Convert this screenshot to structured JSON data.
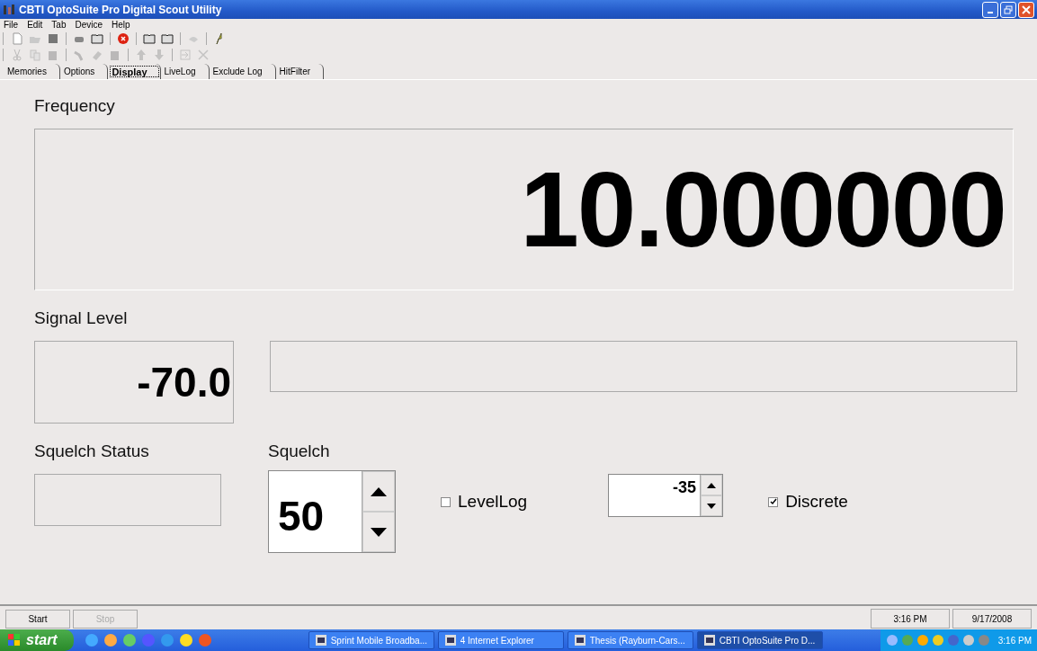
{
  "window": {
    "title": "CBTI OptoSuite Pro Digital Scout Utility"
  },
  "menu": [
    "File",
    "Edit",
    "Tab",
    "Device",
    "Help"
  ],
  "tabs": [
    {
      "label": "Memories",
      "selected": false
    },
    {
      "label": "Options",
      "selected": false
    },
    {
      "label": "Display",
      "selected": true
    },
    {
      "label": "LiveLog",
      "selected": false
    },
    {
      "label": "Exclude Log",
      "selected": false
    },
    {
      "label": "HitFilter",
      "selected": false
    }
  ],
  "frequency": {
    "label": "Frequency",
    "value": "10.000000"
  },
  "signal": {
    "label": "Signal Level",
    "reading": "-70.0"
  },
  "squelch_status": {
    "label": "Squelch Status"
  },
  "squelch": {
    "label": "Squelch",
    "value": "50"
  },
  "levellog": {
    "label": "LevelLog",
    "checked": false,
    "value": "-35"
  },
  "discrete": {
    "label": "Discrete",
    "checked": true
  },
  "buttons": [
    {
      "label": "Start",
      "disabled": false
    },
    {
      "label": "Stop",
      "disabled": true
    }
  ],
  "status_bar": {
    "time": "3:16 PM",
    "date": "9/17/2008"
  },
  "taskbar": {
    "start": "start",
    "tasks": [
      {
        "label": "Sprint Mobile Broadba...",
        "selected": false
      },
      {
        "label": "4 Internet Explorer",
        "selected": false
      },
      {
        "label": "Thesis (Rayburn-Cars...",
        "selected": false
      },
      {
        "label": "CBTI OptoSuite Pro D...",
        "selected": true
      }
    ],
    "clock": "3:16 PM"
  }
}
